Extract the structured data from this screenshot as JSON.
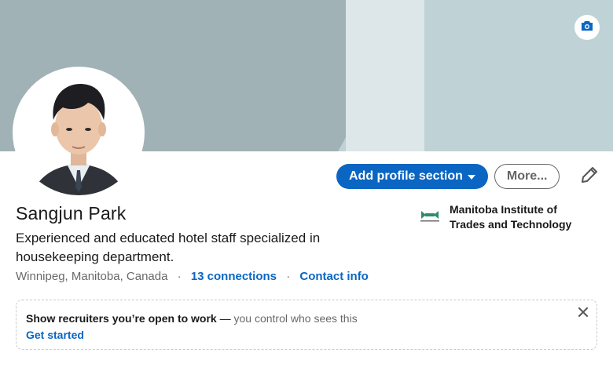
{
  "profile": {
    "name": "Sangjun Park",
    "headline": "Experienced and educated hotel staff specialized in housekeeping department.",
    "location": "Winnipeg, Manitoba, Canada",
    "connections": "13 connections",
    "contact_info": "Contact info",
    "separator": "·"
  },
  "actions": {
    "add_section_label": "Add profile section",
    "more_label": "More..."
  },
  "education": {
    "school": "Manitoba Institute of Trades and Technology"
  },
  "open_to_work": {
    "title": "Show recruiters you’re open to work",
    "dash": " — ",
    "subtitle": "you control who sees this",
    "cta": "Get started"
  },
  "icons": {
    "banner_edit": "camera-icon",
    "edit": "pencil-icon",
    "dropdown": "caret-down-icon",
    "close": "close-icon",
    "school_logo": "school-logo-icon"
  },
  "colors": {
    "accent": "#0a66c2",
    "banner_light": "#bfd2d6",
    "banner_dark": "#a0b2b6"
  }
}
